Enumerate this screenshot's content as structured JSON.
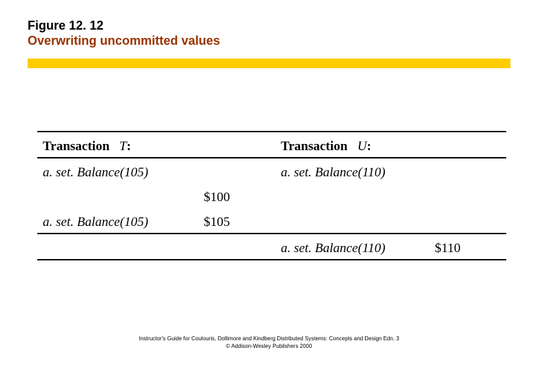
{
  "title": {
    "line1": "Figure 12. 12",
    "line2": "Overwriting uncommitted values"
  },
  "table": {
    "header": {
      "t_label": "Transaction",
      "t_var": "T",
      "u_label": "Transaction",
      "u_var": "U"
    },
    "rows": {
      "r1_t": "a. set. Balance(105)",
      "r1_u": "a. set. Balance(110)",
      "r2_t": "a. set. Balance(105)",
      "r2_v1": "$100",
      "r2_v2": "$105",
      "r3_u": "a. set. Balance(110)",
      "r3_v": "$110"
    }
  },
  "footer": {
    "line1": "Instructor's Guide for  Coulouris, Dollimore and Kindberg   Distributed Systems: Concepts and Design   Edn. 3",
    "line2": "©  Addison-Wesley Publishers 2000"
  }
}
